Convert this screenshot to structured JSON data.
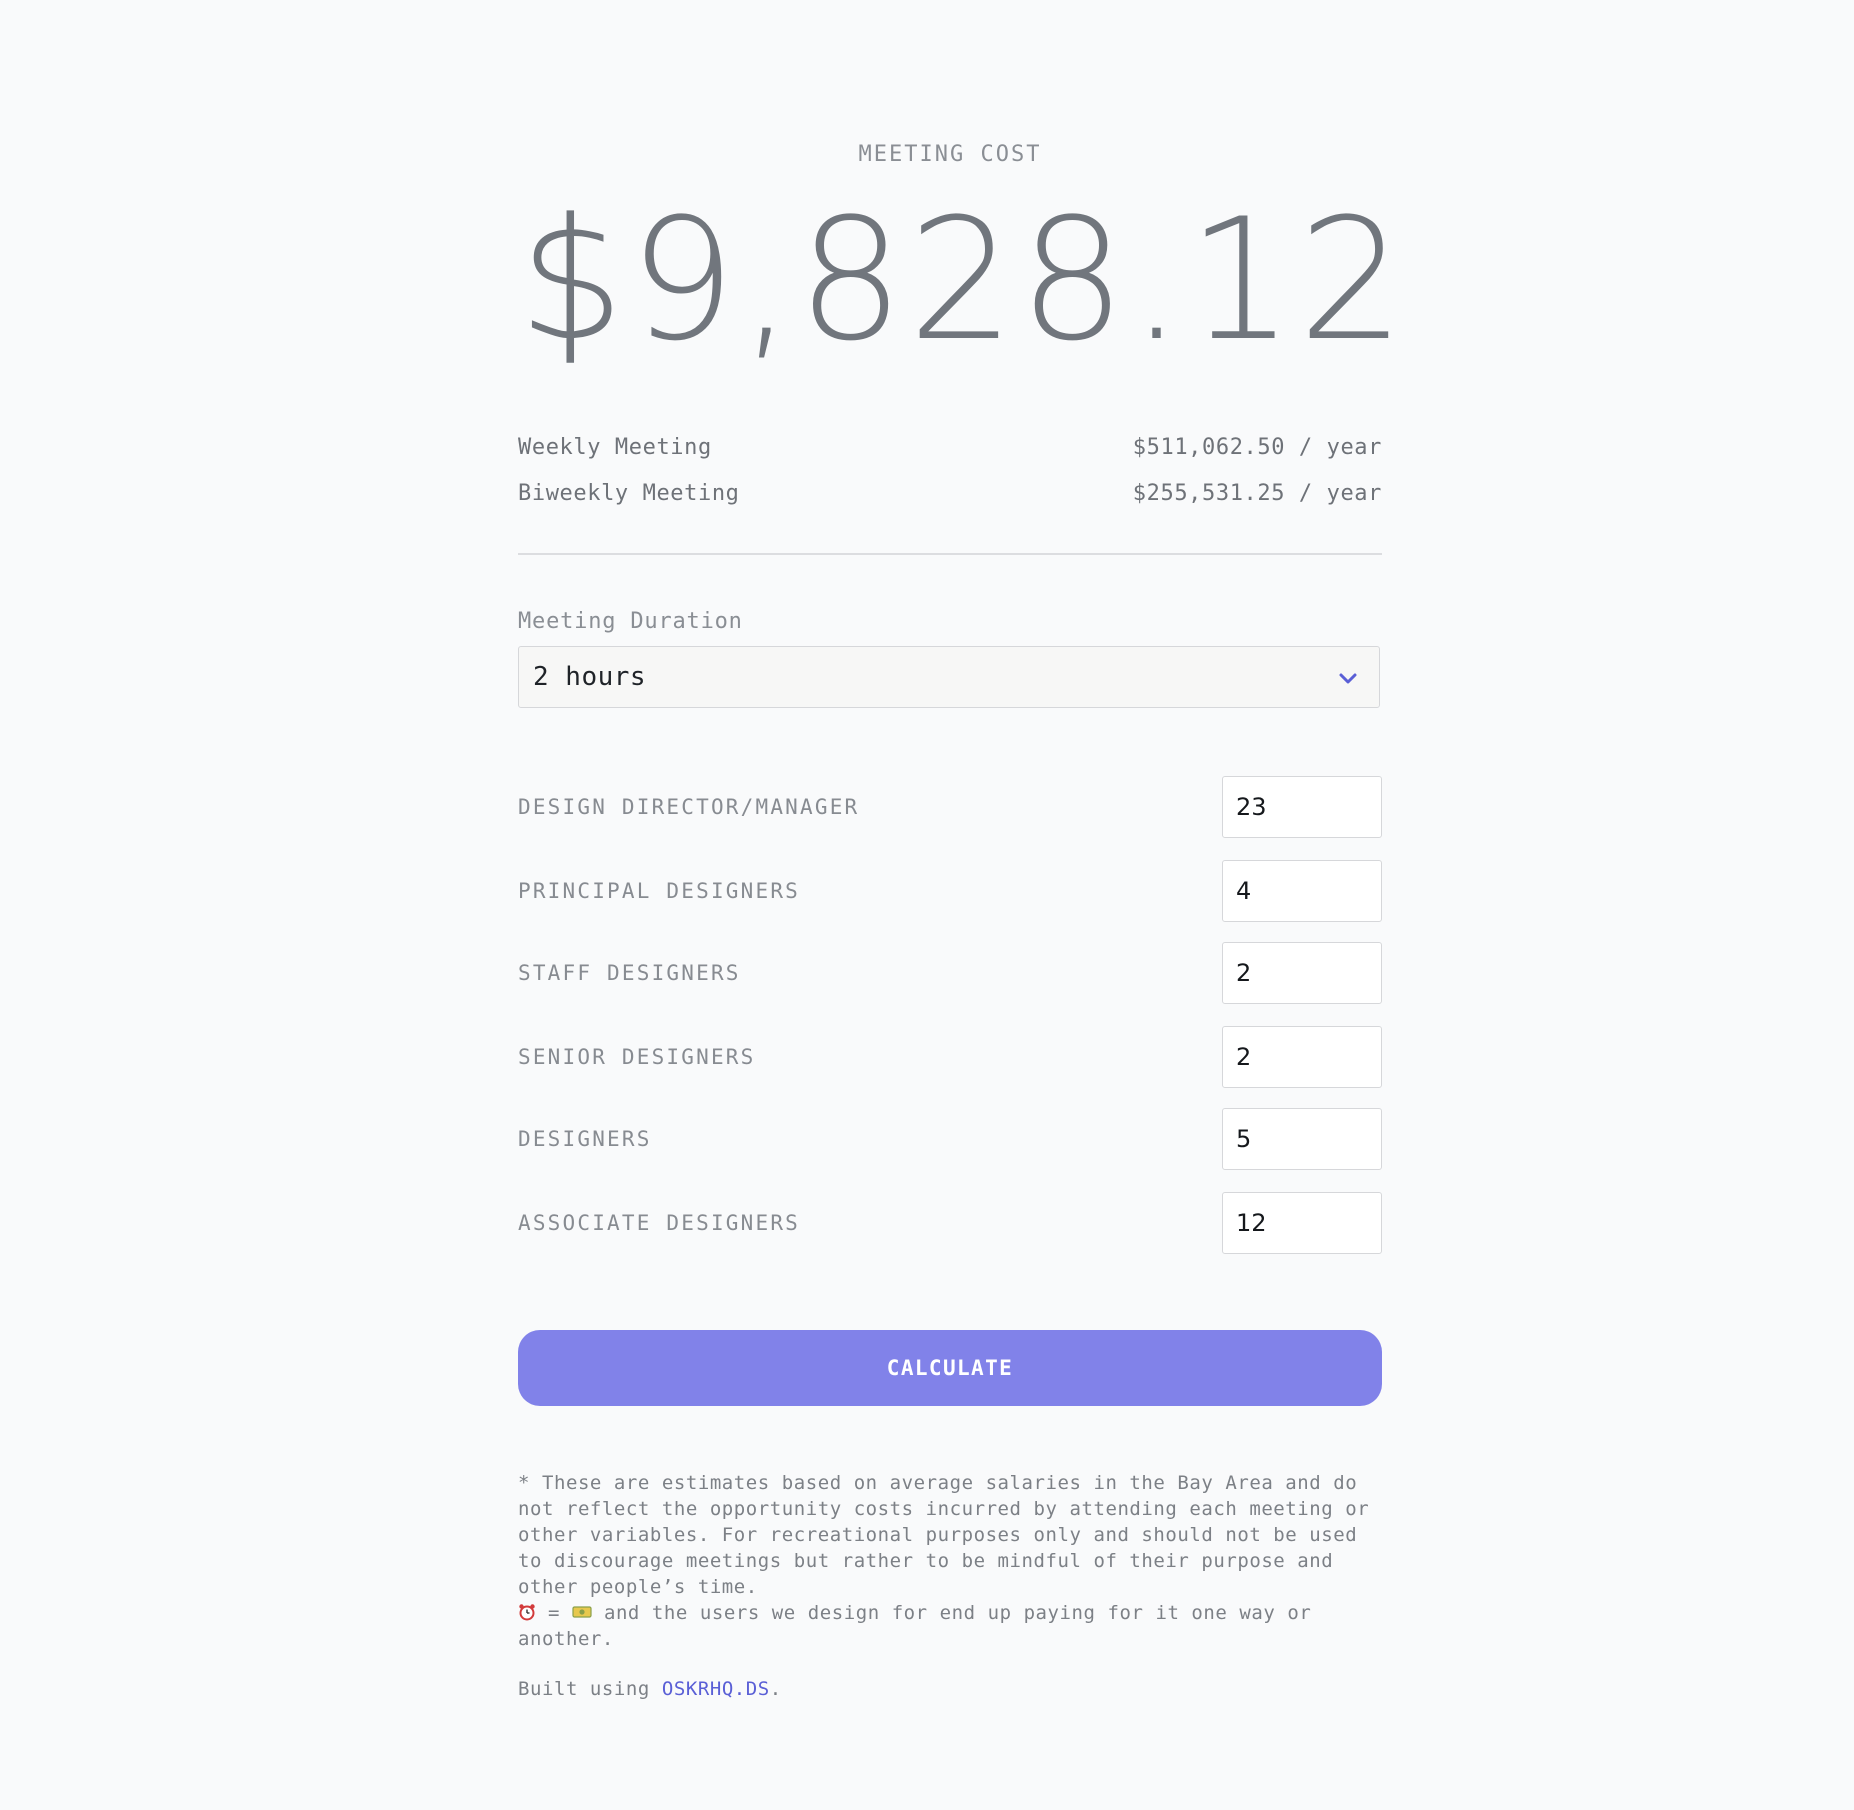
{
  "header": {
    "label": "MEETING COST",
    "total": "$9,828.12"
  },
  "summary": [
    {
      "label": "Weekly Meeting",
      "value": "$511,062.50 / year"
    },
    {
      "label": "Biweekly Meeting",
      "value": "$255,531.25 / year"
    }
  ],
  "duration": {
    "label": "Meeting Duration",
    "selected": "2 hours",
    "icon": "chevron-down-icon",
    "accent": "#5a5fd6"
  },
  "roles": [
    {
      "label": "DESIGN DIRECTOR/MANAGER",
      "value": "23"
    },
    {
      "label": "PRINCIPAL DESIGNERS",
      "value": "4"
    },
    {
      "label": "STAFF DESIGNERS",
      "value": "2"
    },
    {
      "label": "SENIOR DESIGNERS",
      "value": "2"
    },
    {
      "label": "DESIGNERS",
      "value": "5"
    },
    {
      "label": "ASSOCIATE DESIGNERS",
      "value": "12"
    }
  ],
  "calculate": {
    "label": "CALCULATE",
    "color": "#8182e9"
  },
  "footnote": {
    "disclaimer": "* These are estimates based on average salaries in the Bay Area and do not reflect the opportunity costs incurred by attending each meeting or other variables. For recreational purposes only and should not be used to discourage meetings but rather to be mindful of their purpose and other people’s time.",
    "emoji_eq": " = ",
    "emoji_tail": " and the users we design for end up paying for it one way or another.",
    "emoji_icons": [
      "alarm-clock-icon",
      "money-icon"
    ],
    "built_prefix": "Built using ",
    "built_link": "OSKRHQ.DS",
    "built_suffix": "."
  }
}
